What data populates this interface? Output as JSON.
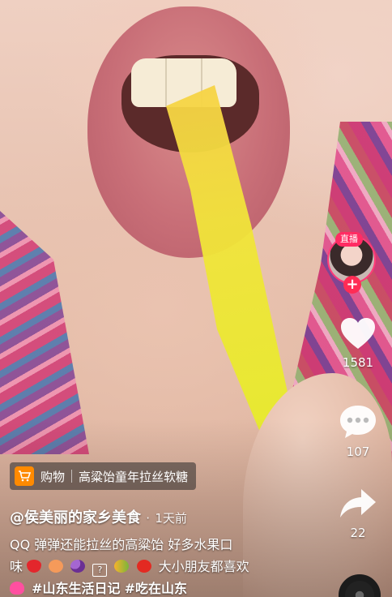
{
  "live": {
    "badge": "直播"
  },
  "actions": {
    "like_count": "1581",
    "comment_count": "107",
    "share_count": "22"
  },
  "shop": {
    "label": "购物",
    "product": "高粱饴童年拉丝软糖"
  },
  "author": {
    "handle": "@侯美丽的家乡美食",
    "dot": "·",
    "time": "1天前"
  },
  "description": {
    "line1": "QQ 弹弹还能拉丝的高粱饴 好多水果口",
    "line2_prefix": "味",
    "line2_suffix": "大小朋友都喜欢",
    "hashtags": [
      "#山东生活日记",
      "#吃在山东"
    ]
  },
  "icons": [
    "heart-icon",
    "comment-icon",
    "share-icon",
    "cart-icon",
    "plus-icon"
  ],
  "colors": {
    "accent": "#ff2c55",
    "shop": "#ff8a00"
  }
}
